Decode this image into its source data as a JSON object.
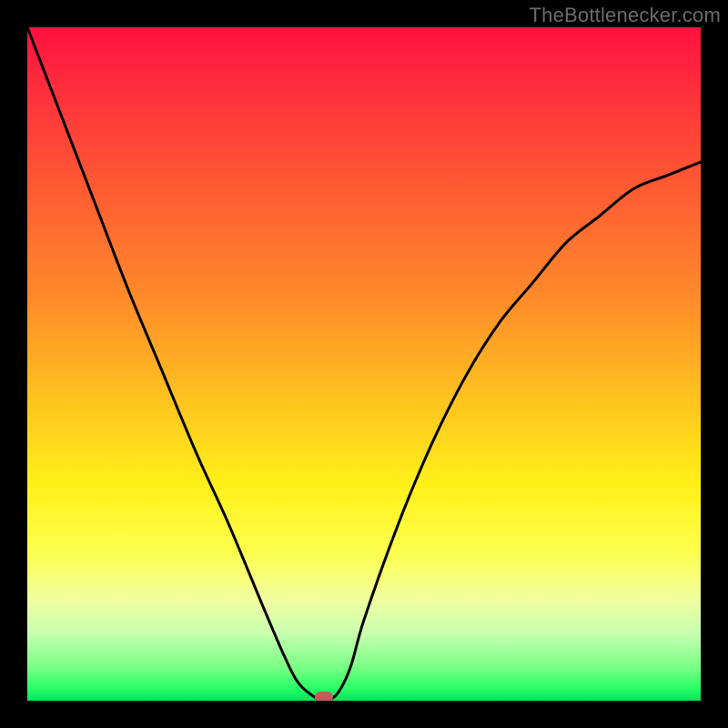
{
  "watermark": "TheBottlenecker.com",
  "chart_data": {
    "type": "line",
    "title": "",
    "xlabel": "",
    "ylabel": "",
    "xlim": [
      0,
      100
    ],
    "ylim": [
      0,
      100
    ],
    "x": [
      0,
      5,
      10,
      15,
      20,
      25,
      30,
      35,
      38,
      40,
      42,
      44,
      46,
      48,
      50,
      55,
      60,
      65,
      70,
      75,
      80,
      85,
      90,
      95,
      100
    ],
    "values": [
      100,
      87,
      74,
      61,
      49,
      37,
      26,
      14,
      7,
      3,
      1,
      0,
      1,
      5,
      12,
      26,
      38,
      48,
      56,
      62,
      68,
      72,
      76,
      78,
      80
    ],
    "marker": {
      "x": 44,
      "y": 0
    },
    "background_gradient": {
      "stops": [
        {
          "pos": 0.0,
          "color": "#ff1040"
        },
        {
          "pos": 0.22,
          "color": "#ff5534"
        },
        {
          "pos": 0.55,
          "color": "#ffc21f"
        },
        {
          "pos": 0.78,
          "color": "#fdff4d"
        },
        {
          "pos": 0.95,
          "color": "#7aff85"
        },
        {
          "pos": 1.0,
          "color": "#00e65c"
        }
      ]
    }
  }
}
